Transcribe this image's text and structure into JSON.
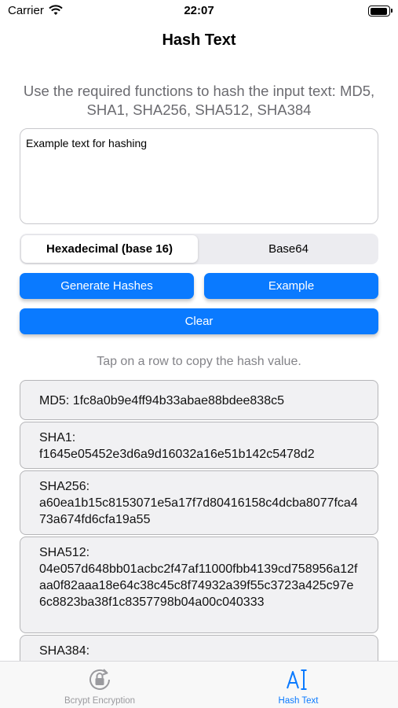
{
  "status_bar": {
    "carrier": "Carrier",
    "time": "22:07"
  },
  "nav": {
    "title": "Hash Text"
  },
  "instructions": "Use the required functions to hash the input text: MD5, SHA1, SHA256, SHA512, SHA384",
  "input": {
    "value": "Example text for hashing"
  },
  "encoding": {
    "options": [
      "Hexadecimal (base 16)",
      "Base64"
    ],
    "selected": "Hexadecimal (base 16)"
  },
  "buttons": {
    "generate": "Generate Hashes",
    "example": "Example",
    "clear": "Clear"
  },
  "hint": "Tap on a row to copy the hash value.",
  "hashes": [
    {
      "label": "MD5:",
      "value": "1fc8a0b9e4ff94b33abae88bdee838c5"
    },
    {
      "label": "SHA1:",
      "value": "f1645e05452e3d6a9d16032a16e51b142c5478d2"
    },
    {
      "label": "SHA256:",
      "value": "a60ea1b15c8153071e5a17f7d80416158c4dcba8077fca473a674fd6cfa19a55"
    },
    {
      "label": "SHA512:",
      "value": "04e057d648bb01acbc2f47af11000fbb4139cd758956a12faa0f82aaa18e64c38c45c8f74932a39f55c3723a425c97e6c8823ba38f1c8357798b04a00c040333"
    },
    {
      "label": "SHA384:",
      "value": ""
    }
  ],
  "tab_bar": {
    "items": [
      {
        "label": "Bcrypt Encryption",
        "icon": "lock-rotation-icon",
        "active": false
      },
      {
        "label": "Hash Text",
        "icon": "text-cursor-icon",
        "active": true
      }
    ]
  },
  "colors": {
    "accent": "#0a7aff",
    "row_bg": "#f1f1f3",
    "muted_text": "#6b6b70"
  }
}
